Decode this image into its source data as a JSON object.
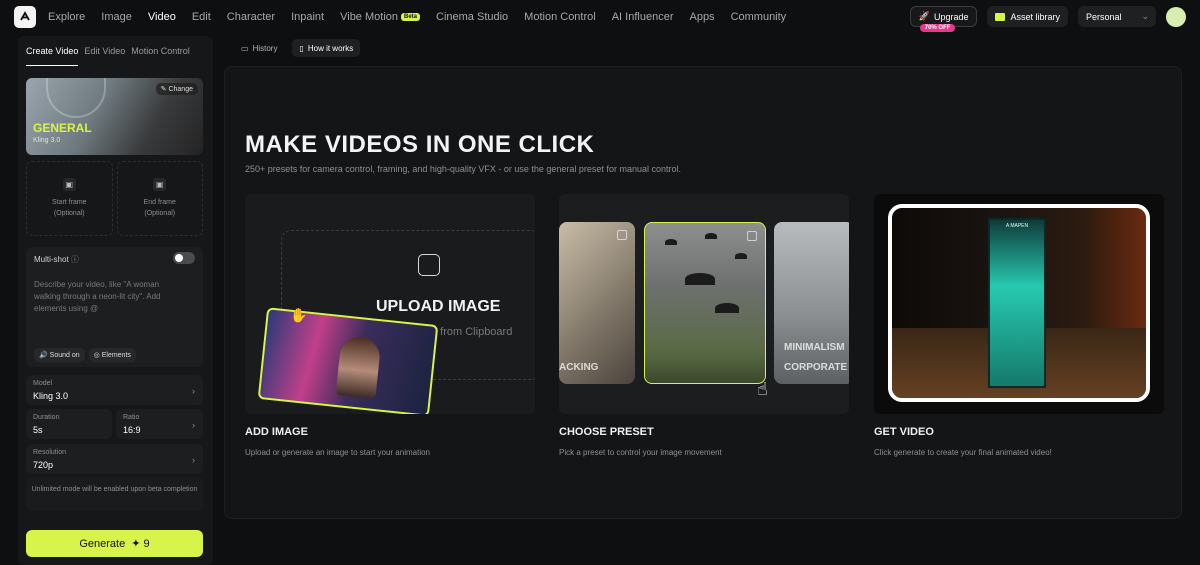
{
  "nav": {
    "items": [
      "Explore",
      "Image",
      "Video",
      "Edit",
      "Character",
      "Inpaint",
      "Vibe Motion",
      "Cinema Studio",
      "Motion Control",
      "AI Influencer",
      "Apps",
      "Community"
    ],
    "active": "Video",
    "beta_label": "Beta"
  },
  "header": {
    "upgrade_label": "Upgrade",
    "discount_badge": "70% OFF",
    "asset_library_label": "Asset library",
    "workspace_label": "Personal"
  },
  "sidebar": {
    "tabs": [
      "Create Video",
      "Edit Video",
      "Motion Control"
    ],
    "preset": {
      "change_label": "Change",
      "name": "GENERAL",
      "model": "Kling 3.0"
    },
    "start_frame": {
      "label": "Start frame",
      "hint": "(Optional)"
    },
    "end_frame": {
      "label": "End frame",
      "hint": "(Optional)"
    },
    "multishot_label": "Multi-shot",
    "prompt_placeholder": "Describe your video, like \"A woman walking through a neon-lit city\". Add elements using @",
    "sound_label": "Sound on",
    "elements_label": "Elements",
    "model": {
      "label": "Model",
      "value": "Kling 3.0"
    },
    "duration": {
      "label": "Duration",
      "value": "5s"
    },
    "ratio": {
      "label": "Ratio",
      "value": "16:9"
    },
    "resolution": {
      "label": "Resolution",
      "value": "720p"
    },
    "note": "Unlimited mode will be enabled upon beta completion",
    "generate": {
      "label": "Generate",
      "cost": "9"
    }
  },
  "subtabs": {
    "history": "History",
    "how_it_works": "How it works"
  },
  "main": {
    "title": "MAKE VIDEOS IN ONE CLICK",
    "subtitle": "250+ presets for camera control, framing, and high-quality VFX - or use the general preset for manual control.",
    "upload_title": "UPLOAD IMAGE",
    "upload_sub": "Paste from Clipboard",
    "preset_labels": [
      "ACKING",
      "MINIMALISM",
      "CORPORATE"
    ],
    "steps": [
      {
        "title": "ADD IMAGE",
        "desc": "Upload or generate an image to start your animation"
      },
      {
        "title": "CHOOSE PRESET",
        "desc": "Pick a preset to control your image movement"
      },
      {
        "title": "GET VIDEO",
        "desc": "Click generate to create your final animated video!"
      }
    ],
    "booth_sign": "A MAPEN"
  },
  "colors": {
    "accent": "#d8f34a",
    "badge": "#e43a8c",
    "background": "#0e0f10"
  }
}
